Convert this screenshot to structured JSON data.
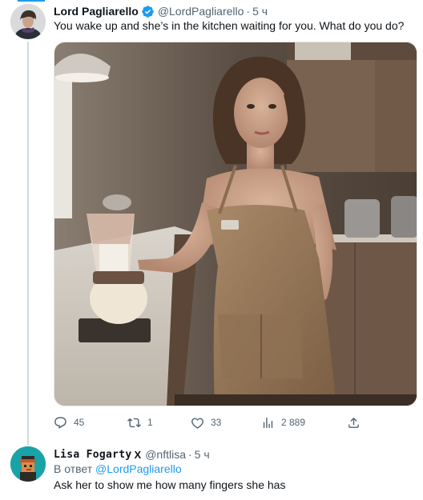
{
  "accent_color": "#1d9bf0",
  "tweet": {
    "author_name": "Lord Pagliarello",
    "handle": "@LordPagliarello",
    "separator": "·",
    "time": "5 ч",
    "verified_icon": "verified-badge-icon",
    "text": "You wake up and she’s in the kitchen waiting for you. What do you do?",
    "media_description_icon": "photo-image",
    "actions": {
      "replies": "45",
      "retweets": "1",
      "likes": "33",
      "views": "2 889"
    }
  },
  "reply": {
    "author_name": "Lisa Fogarty",
    "name_suffix_icon": "X",
    "handle": "@nftlisa",
    "separator": "·",
    "time": "5 ч",
    "replying_to_label": "В ответ",
    "replying_to_handle": "@LordPagliarello",
    "text": "Ask her to show me how many fingers she has"
  }
}
